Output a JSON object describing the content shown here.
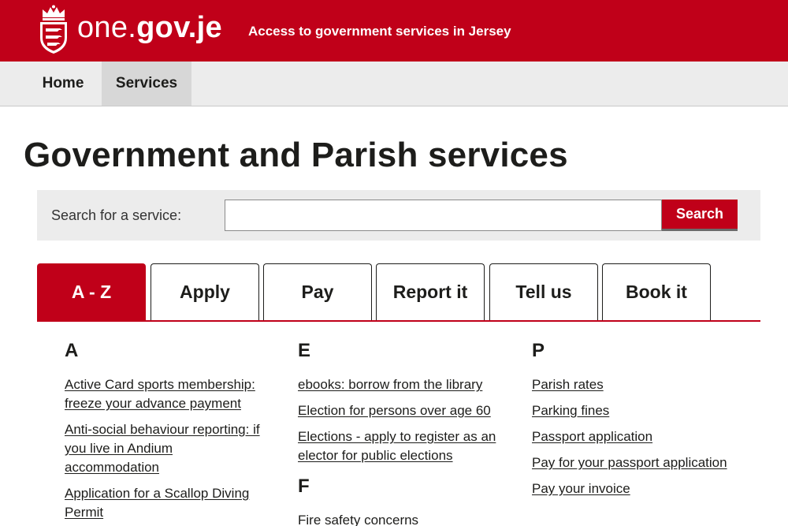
{
  "header": {
    "logo_icon": "jersey-crest-icon",
    "brand_light": "one.",
    "brand_bold": "gov.je",
    "tagline": "Access to government services in Jersey",
    "background": "#c00019"
  },
  "nav": {
    "items": [
      {
        "label": "Home"
      },
      {
        "label": "Services"
      }
    ]
  },
  "page": {
    "title": "Government and Parish services"
  },
  "search": {
    "label": "Search for a service:",
    "value": "",
    "placeholder": "",
    "button_label": "Search"
  },
  "tabs": [
    {
      "label": "A - Z"
    },
    {
      "label": "Apply"
    },
    {
      "label": "Pay"
    },
    {
      "label": "Report it"
    },
    {
      "label": "Tell us"
    },
    {
      "label": "Book it"
    }
  ],
  "columns": [
    {
      "sections": [
        {
          "letter": "A",
          "links": [
            "Active Card sports membership: freeze your advance payment",
            "Anti-social behaviour reporting: if you live in Andium accommodation",
            "Application for a Scallop Diving Permit"
          ]
        }
      ]
    },
    {
      "sections": [
        {
          "letter": "E",
          "links": [
            "ebooks: borrow from the library",
            "Election for persons over age 60",
            "Elections - apply to register as an elector for public elections"
          ]
        },
        {
          "letter": "F",
          "links": [
            "Fire safety concerns"
          ]
        }
      ]
    },
    {
      "sections": [
        {
          "letter": "P",
          "links": [
            "Parish rates",
            "Parking fines",
            "Passport application",
            "Pay for your passport application",
            "Pay your invoice"
          ]
        }
      ]
    }
  ]
}
